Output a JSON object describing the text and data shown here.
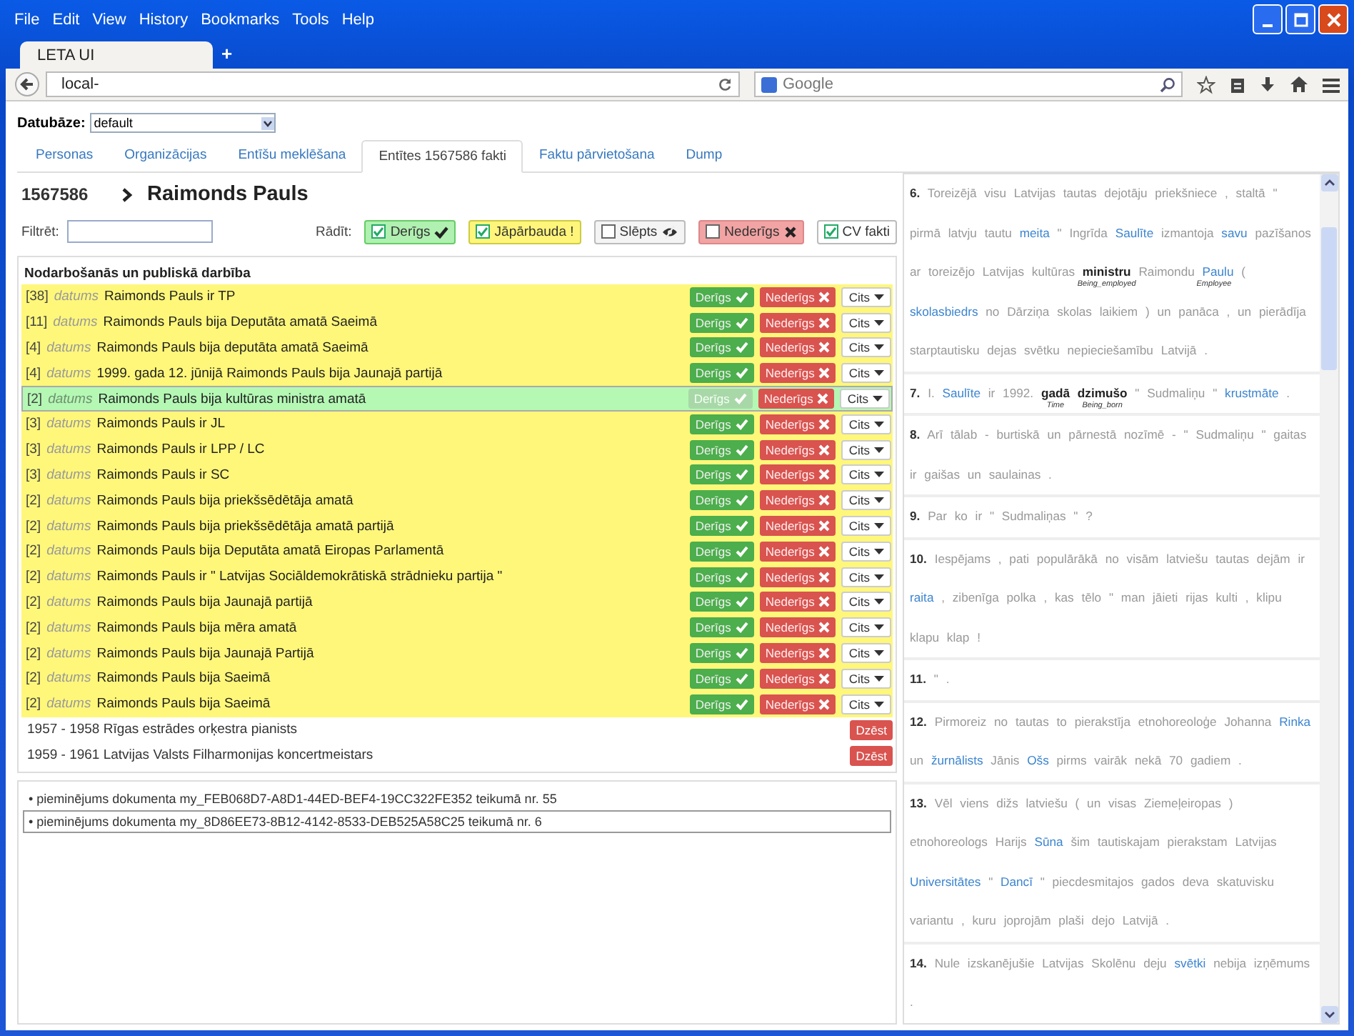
{
  "browser": {
    "menu": [
      "File",
      "Edit",
      "View",
      "History",
      "Bookmarks",
      "Tools",
      "Help"
    ],
    "tab": "LETA UI",
    "new_tab": "+",
    "address": "local-",
    "search_placeholder": "Google"
  },
  "database": {
    "label": "Datubāze:",
    "value": "default"
  },
  "tabs": [
    {
      "label": "Personas",
      "selected": false
    },
    {
      "label": "Organizācijas",
      "selected": false
    },
    {
      "label": "Entīšu meklēšana",
      "selected": false
    },
    {
      "label": "Entītes 1567586 fakti",
      "selected": true
    },
    {
      "label": "Faktu pārvietošana",
      "selected": false
    },
    {
      "label": "Dump",
      "selected": false
    }
  ],
  "entity": {
    "id": "1567586",
    "name": "Raimonds Pauls"
  },
  "filter": {
    "label": "Filtrēt:"
  },
  "show": {
    "label": "Rādīt:",
    "toggles": [
      {
        "kind": "valid",
        "label": "Derīgs",
        "checked": true
      },
      {
        "kind": "review",
        "label": "Jāpārbauda !",
        "checked": true
      },
      {
        "kind": "hidden",
        "label": "Slēpts",
        "checked": false
      },
      {
        "kind": "invalid",
        "label": "Nederīgs",
        "checked": false
      },
      {
        "kind": "cv",
        "label": "CV fakti",
        "checked": true
      }
    ]
  },
  "section_title": "Nodarbošanās un publiskā darbība",
  "facts": [
    {
      "count": "[38]",
      "date": "datums",
      "text": "Raimonds Pauls ir TP",
      "valid": false,
      "buttons": [
        "Derīgs",
        "Nederīgs",
        "Cits"
      ]
    },
    {
      "count": "[11]",
      "date": "datums",
      "text": "Raimonds Pauls bija Deputāta amatā Saeimā",
      "valid": false,
      "buttons": [
        "Derīgs",
        "Nederīgs",
        "Cits"
      ]
    },
    {
      "count": "[4]",
      "date": "datums",
      "text": "Raimonds Pauls bija deputāta amatā Saeimā",
      "valid": false,
      "buttons": [
        "Derīgs",
        "Nederīgs",
        "Cits"
      ]
    },
    {
      "count": "[4]",
      "date": "datums",
      "text": "1999. gada 12. jūnijā Raimonds Pauls bija Jaunajā partijā",
      "valid": false,
      "buttons": [
        "Derīgs",
        "Nederīgs",
        "Cits"
      ]
    },
    {
      "count": "[2]",
      "date": "datums",
      "text": "Raimonds Pauls bija kultūras ministra amatā",
      "valid": true,
      "buttons": [
        "Derīgs",
        "Nederīgs",
        "Cits"
      ]
    },
    {
      "count": "[3]",
      "date": "datums",
      "text": "Raimonds Pauls ir JL",
      "valid": false,
      "buttons": [
        "Derīgs",
        "Nederīgs",
        "Cits"
      ]
    },
    {
      "count": "[3]",
      "date": "datums",
      "text": "Raimonds Pauls ir LPP / LC",
      "valid": false,
      "buttons": [
        "Derīgs",
        "Nederīgs",
        "Cits"
      ]
    },
    {
      "count": "[3]",
      "date": "datums",
      "text": "Raimonds Pauls ir SC",
      "valid": false,
      "buttons": [
        "Derīgs",
        "Nederīgs",
        "Cits"
      ]
    },
    {
      "count": "[2]",
      "date": "datums",
      "text": "Raimonds Pauls bija priekšsēdētāja amatā",
      "valid": false,
      "buttons": [
        "Derīgs",
        "Nederīgs",
        "Cits"
      ]
    },
    {
      "count": "[2]",
      "date": "datums",
      "text": "Raimonds Pauls bija priekšsēdētāja amatā partijā",
      "valid": false,
      "buttons": [
        "Derīgs",
        "Nederīgs",
        "Cits"
      ]
    },
    {
      "count": "[2]",
      "date": "datums",
      "text": "Raimonds Pauls bija Deputāta amatā Eiropas Parlamentā",
      "valid": false,
      "buttons": [
        "Derīgs",
        "Nederīgs",
        "Cits"
      ]
    },
    {
      "count": "[2]",
      "date": "datums",
      "text": "Raimonds Pauls ir \" Latvijas Sociāldemokrātiskā strādnieku partija \"",
      "valid": false,
      "buttons": [
        "Derīgs",
        "Nederīgs",
        "Cits"
      ]
    },
    {
      "count": "[2]",
      "date": "datums",
      "text": "Raimonds Pauls bija Jaunajā partijā",
      "valid": false,
      "buttons": [
        "Derīgs",
        "Nederīgs",
        "Cits"
      ]
    },
    {
      "count": "[2]",
      "date": "datums",
      "text": "Raimonds Pauls bija mēra amatā",
      "valid": false,
      "buttons": [
        "Derīgs",
        "Nederīgs",
        "Cits"
      ]
    },
    {
      "count": "[2]",
      "date": "datums",
      "text": "Raimonds Pauls bija Jaunajā Partijā",
      "valid": false,
      "buttons": [
        "Derīgs",
        "Nederīgs",
        "Cits"
      ]
    },
    {
      "count": "[2]",
      "date": "datums",
      "text": "Raimonds Pauls bija Saeimā",
      "valid": false,
      "buttons": [
        "Derīgs",
        "Nederīgs",
        "Cits"
      ]
    },
    {
      "count": "[2]",
      "date": "datums",
      "text": "Raimonds Pauls bija Saeimā",
      "valid": false,
      "buttons": [
        "Derīgs",
        "Nederīgs",
        "Cits"
      ]
    }
  ],
  "cv_facts": [
    {
      "text": "1957 - 1958 Rīgas estrādes orķestra pianists",
      "button": "Dzēst"
    },
    {
      "text": "1959 - 1961 Latvijas Valsts Filharmonijas koncertmeistars",
      "button": "Dzēst"
    }
  ],
  "mentions": [
    {
      "text": "• pieminējums dokumenta my_FEB068D7-A8D1-44ED-BEF4-19CC322FE352 teikumā nr. 55",
      "selected": false
    },
    {
      "text": "• pieminējums dokumenta my_8D86EE73-8B12-4142-8533-DEB525A58C25 teikumā nr. 6",
      "selected": true
    }
  ],
  "sentences": [
    {
      "number": "6.",
      "parts": [
        {
          "kind": "plain",
          "text": "Toreizējā visu Latvijas tautas dejotāju priekšniece , staltā \" pirmā latvju tautu"
        },
        {
          "kind": "link",
          "text": "meita"
        },
        {
          "kind": "plain",
          "text": "\" Ingrīda"
        },
        {
          "kind": "link",
          "text": "Saulīte"
        },
        {
          "kind": "plain",
          "text": "izmantoja"
        },
        {
          "kind": "link",
          "text": "savu"
        },
        {
          "kind": "plain",
          "text": "pazīšanos ar toreizējo Latvijas kultūras"
        },
        {
          "kind": "frame",
          "text": "ministru",
          "label": "Being_employed"
        },
        {
          "kind": "plain",
          "text": "Raimondu"
        },
        {
          "kind": "link",
          "text": "Paulu",
          "label": "Employee"
        },
        {
          "kind": "plain",
          "text": "("
        },
        {
          "kind": "link",
          "text": "skolasbiedrs"
        },
        {
          "kind": "plain",
          "text": "no Dārziņa skolas laikiem ) un panāca , un pierādīja starptautisku dejas svētku nepieciešamību Latvijā ."
        }
      ]
    },
    {
      "number": "7.",
      "parts": [
        {
          "kind": "plain",
          "text": "I."
        },
        {
          "kind": "link",
          "text": "Saulīte"
        },
        {
          "kind": "plain",
          "text": "ir 1992."
        },
        {
          "kind": "frame",
          "text": "gadā",
          "label": "Time"
        },
        {
          "kind": "frame",
          "text": "dzimušo",
          "label": "Being_born"
        },
        {
          "kind": "plain",
          "text": "\" Sudmaliņu \""
        },
        {
          "kind": "link",
          "text": "krustmāte"
        },
        {
          "kind": "plain",
          "text": "."
        }
      ]
    },
    {
      "number": "8.",
      "parts": [
        {
          "kind": "plain",
          "text": "Arī tālab - burtiskā un pārnestā nozīmē - \" Sudmaliņu \" gaitas ir gaišas un saulainas ."
        }
      ]
    },
    {
      "number": "9.",
      "parts": [
        {
          "kind": "plain",
          "text": "Par ko ir \" Sudmaliņas \" ?"
        }
      ]
    },
    {
      "number": "10.",
      "parts": [
        {
          "kind": "plain",
          "text": "Iespējams , pati populārākā no visām latviešu tautas dejām ir"
        },
        {
          "kind": "link",
          "text": "raita"
        },
        {
          "kind": "plain",
          "text": ", zibenīga polka , kas tēlo \" man jāieti rijas kulti , klipu klapu klap !"
        }
      ]
    },
    {
      "number": "11.",
      "parts": [
        {
          "kind": "plain",
          "text": "\" ."
        }
      ]
    },
    {
      "number": "12.",
      "parts": [
        {
          "kind": "plain",
          "text": "Pirmoreiz no tautas to pierakstīja etnohoreoloģe Johanna"
        },
        {
          "kind": "link",
          "text": "Rinka"
        },
        {
          "kind": "plain",
          "text": "un"
        },
        {
          "kind": "link",
          "text": "žurnālists"
        },
        {
          "kind": "plain",
          "text": "Jānis"
        },
        {
          "kind": "link",
          "text": "Ošs"
        },
        {
          "kind": "plain",
          "text": "pirms vairāk nekā 70 gadiem ."
        }
      ]
    },
    {
      "number": "13.",
      "parts": [
        {
          "kind": "plain",
          "text": "Vēl viens dižs latviešu ( un visas Ziemeļeiropas ) etnohoreologs Harijs"
        },
        {
          "kind": "link",
          "text": "Sūna"
        },
        {
          "kind": "plain",
          "text": "šim tautiskajam pierakstam Latvijas"
        },
        {
          "kind": "link",
          "text": "Universitātes"
        },
        {
          "kind": "plain",
          "text": "\""
        },
        {
          "kind": "link",
          "text": "Dancī"
        },
        {
          "kind": "plain",
          "text": "\" piecdesmitajos gados deva skatuvisku variantu , kuru joprojām plaši dejo Latvijā ."
        }
      ]
    },
    {
      "number": "14.",
      "parts": [
        {
          "kind": "plain",
          "text": "Nule izskanējušie Latvijas Skolēnu deju"
        },
        {
          "kind": "link",
          "text": "svētki"
        },
        {
          "kind": "plain",
          "text": "nebija izņēmums ."
        }
      ]
    }
  ]
}
